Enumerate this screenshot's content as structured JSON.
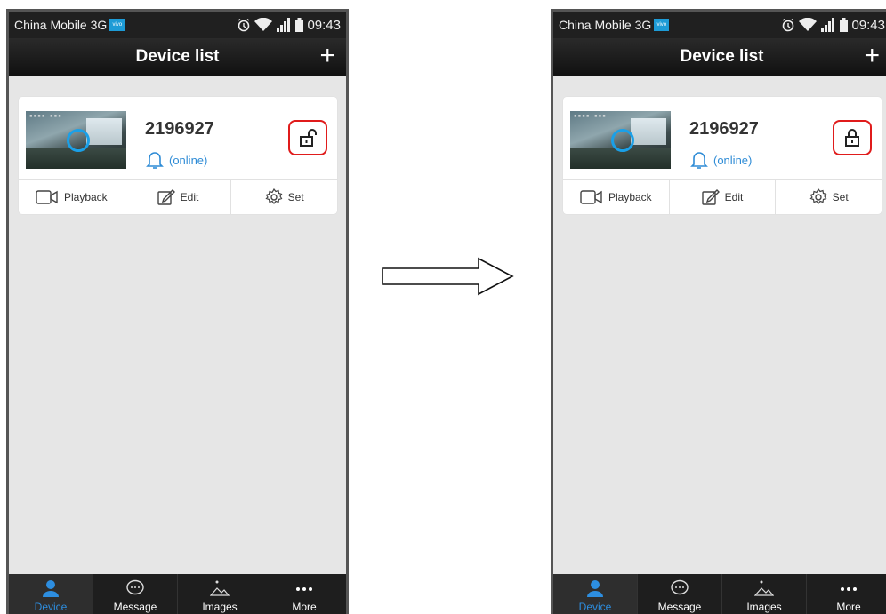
{
  "panels": [
    {
      "status": {
        "carrier": "China Mobile 3G",
        "badge": "vivo",
        "time": "09:43"
      },
      "header": {
        "title": "Device list",
        "add_label": "+"
      },
      "device": {
        "id": "2196927",
        "state": "(online)",
        "lock": "unlocked"
      },
      "actions": [
        {
          "label": "Playback",
          "icon": "video-icon"
        },
        {
          "label": "Edit",
          "icon": "edit-icon"
        },
        {
          "label": "Set",
          "icon": "gear-icon"
        }
      ],
      "tabs": [
        {
          "label": "Device",
          "icon": "person-icon",
          "active": true
        },
        {
          "label": "Message",
          "icon": "chat-icon",
          "active": false
        },
        {
          "label": "Images",
          "icon": "image-icon",
          "active": false
        },
        {
          "label": "More",
          "icon": "more-icon",
          "active": false
        }
      ]
    },
    {
      "status": {
        "carrier": "China Mobile 3G",
        "badge": "vivo",
        "time": "09:43"
      },
      "header": {
        "title": "Device list",
        "add_label": "+"
      },
      "device": {
        "id": "2196927",
        "state": "(online)",
        "lock": "locked"
      },
      "actions": [
        {
          "label": "Playback",
          "icon": "video-icon"
        },
        {
          "label": "Edit",
          "icon": "edit-icon"
        },
        {
          "label": "Set",
          "icon": "gear-icon"
        }
      ],
      "tabs": [
        {
          "label": "Device",
          "icon": "person-icon",
          "active": true
        },
        {
          "label": "Message",
          "icon": "chat-icon",
          "active": false
        },
        {
          "label": "Images",
          "icon": "image-icon",
          "active": false
        },
        {
          "label": "More",
          "icon": "more-icon",
          "active": false
        }
      ]
    }
  ],
  "colors": {
    "accent": "#2d8ee0",
    "highlight": "#e01b1b",
    "online": "#2f8cd6"
  },
  "transition_icon": "right-arrow-icon"
}
